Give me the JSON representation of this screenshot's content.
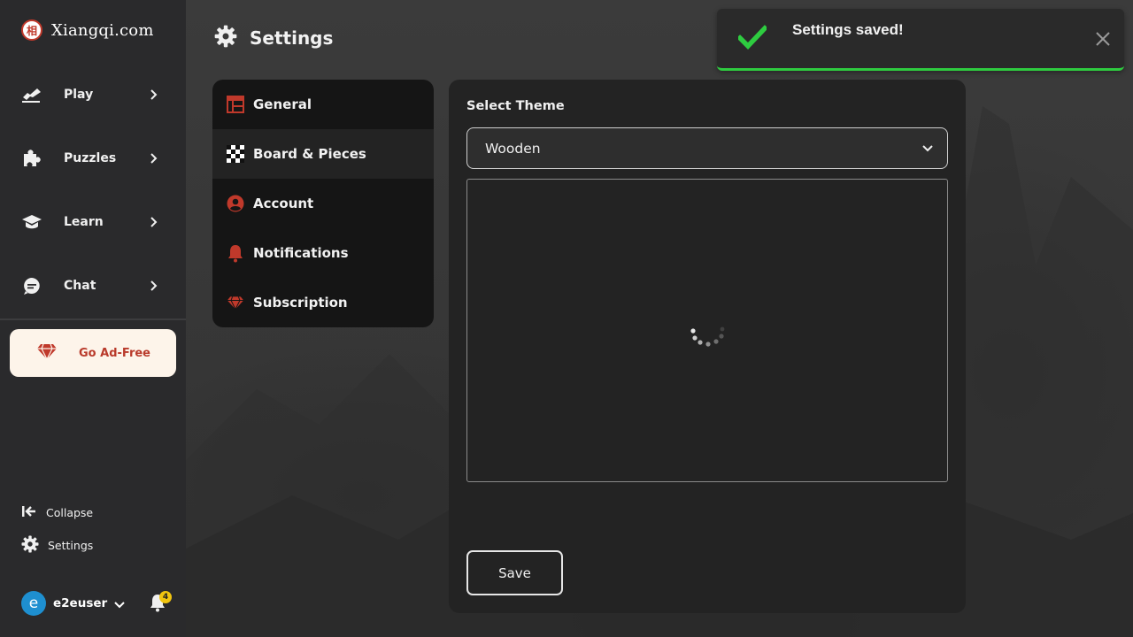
{
  "brand": {
    "name": "Xiangqi.com",
    "logo_char": "相"
  },
  "sidebar": {
    "items": [
      {
        "label": "Play",
        "icon": "play-hand-icon"
      },
      {
        "label": "Puzzles",
        "icon": "puzzle-icon"
      },
      {
        "label": "Learn",
        "icon": "graduation-cap-icon"
      },
      {
        "label": "Chat",
        "icon": "chat-icon"
      }
    ],
    "ad_free": {
      "label": "Go Ad-Free",
      "icon": "diamond-icon"
    },
    "collapse": {
      "label": "Collapse",
      "icon": "collapse-icon"
    },
    "settings": {
      "label": "Settings",
      "icon": "gear-icon"
    },
    "user": {
      "avatar_letter": "e",
      "name": "e2euser",
      "notifications": "4"
    }
  },
  "page": {
    "title": "Settings",
    "icon": "gear-icon"
  },
  "settings_menu": {
    "items": [
      {
        "label": "General",
        "icon": "layout-icon",
        "active": false
      },
      {
        "label": "Board & Pieces",
        "icon": "checkerboard-icon",
        "active": true
      },
      {
        "label": "Account",
        "icon": "user-circle-icon",
        "active": false
      },
      {
        "label": "Notifications",
        "icon": "bell-icon",
        "active": false
      },
      {
        "label": "Subscription",
        "icon": "diamond-icon",
        "active": false
      }
    ]
  },
  "theme": {
    "label": "Select Theme",
    "selected": "Wooden",
    "preview_state": "loading"
  },
  "save_label": "Save",
  "toast": {
    "message": "Settings saved!",
    "status": "success"
  },
  "colors": {
    "accent_red": "#c0392b",
    "success_green": "#2ecc40",
    "badge_yellow": "#f1c40f"
  }
}
